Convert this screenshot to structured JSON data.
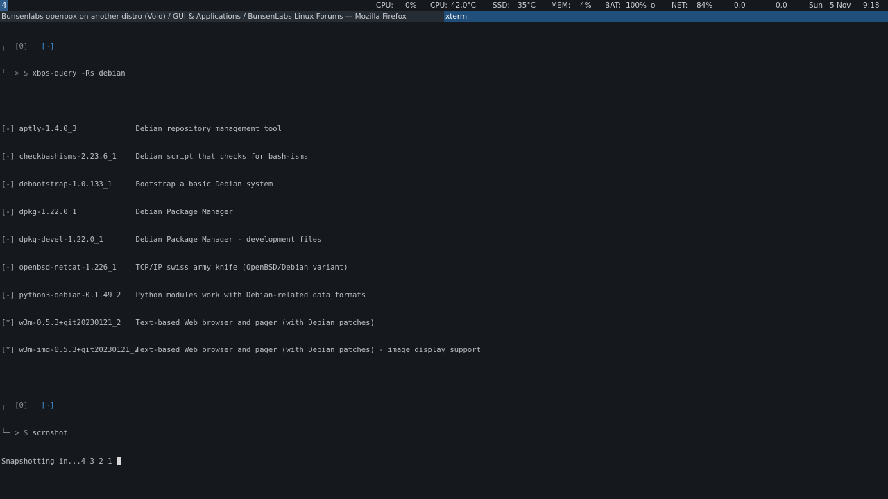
{
  "panel": {
    "workspace": "4",
    "cpu_label": "CPU:",
    "cpu_value": "0%",
    "cpu_temp_label": "CPU:",
    "cpu_temp_value": "42.0°C",
    "ssd_label": "SSD:",
    "ssd_value": "35°C",
    "mem_label": "MEM:",
    "mem_value": "4%",
    "bat_label": "BAT:",
    "bat_value": "100%",
    "bat_state": "o",
    "net_label": "NET:",
    "net_value": "84%",
    "net_down": "0.0",
    "net_up": "0.0",
    "day": "Sun",
    "date": "5 Nov",
    "time": "9:18"
  },
  "taskbar": {
    "firefox_title": "Bunsenlabs openbox on another distro (Void) / GUI & Applications / BunsenLabs Linux Forums — Mozilla Firefox",
    "xterm_title": "xterm"
  },
  "terminal": {
    "prompt1": {
      "box_top": "┌─ [0] ─ ",
      "dir": "[~]",
      "box_bottom": "└─ > $ ",
      "command": "xbps-query -Rs debian"
    },
    "results": [
      {
        "status": "[-]",
        "package": "aptly-1.4.0_3",
        "description": "Debian repository management tool"
      },
      {
        "status": "[-]",
        "package": "checkbashisms-2.23.6_1",
        "description": "Debian script that checks for bash-isms"
      },
      {
        "status": "[-]",
        "package": "debootstrap-1.0.133_1",
        "description": "Bootstrap a basic Debian system"
      },
      {
        "status": "[-]",
        "package": "dpkg-1.22.0_1",
        "description": "Debian Package Manager"
      },
      {
        "status": "[-]",
        "package": "dpkg-devel-1.22.0_1",
        "description": "Debian Package Manager - development files"
      },
      {
        "status": "[-]",
        "package": "openbsd-netcat-1.226_1",
        "description": "TCP/IP swiss army knife (OpenBSD/Debian variant)"
      },
      {
        "status": "[-]",
        "package": "python3-debian-0.1.49_2",
        "description": "Python modules work with Debian-related data formats"
      },
      {
        "status": "[*]",
        "package": "w3m-0.5.3+git20230121_2",
        "description": "Text-based Web browser and pager (with Debian patches)"
      },
      {
        "status": "[*]",
        "package": "w3m-img-0.5.3+git20230121_2",
        "description": "Text-based Web browser and pager (with Debian patches) - image display support"
      }
    ],
    "prompt2": {
      "box_top": "┌─ [0] ─ ",
      "dir": "[~]",
      "box_bottom": "└─ > $ ",
      "command": "scrnshot"
    },
    "output": "Snapshotting in...4 3 2 1 "
  }
}
